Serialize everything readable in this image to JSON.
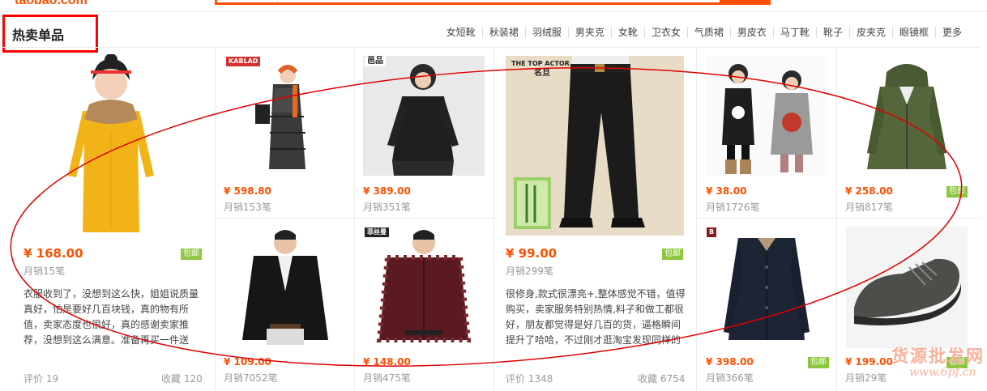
{
  "site": {
    "logo_text": "taobao.com"
  },
  "section": {
    "title": "热卖单品"
  },
  "categories": [
    "女短靴",
    "秋装裙",
    "羽绒服",
    "男夹克",
    "女靴",
    "卫衣女",
    "气质裙",
    "男皮衣",
    "马丁靴",
    "靴子",
    "皮夹克",
    "眼镜框",
    "更多"
  ],
  "featured": [
    {
      "price": "¥ 168.00",
      "badge": "包邮",
      "sales": "月销15笔",
      "review": "衣服收到了，没想到这么快，姐姐说质量真好，怕是要好几百块钱，真的物有所值，卖家态度也很好，真的感谢卖家推荐，没想到这么满意。准备再买一件送",
      "comments": "评价 19",
      "favorites": "收藏 120"
    },
    {
      "price": "¥ 99.00",
      "badge": "包邮",
      "sales": "月销299笔",
      "review": "很修身,款式很漂亮+,整体感觉不错，值得购买，卖家服务特别热情,料子和做工都很好，朋友都觉得是好几百的货，逼格瞬间提升了哈哈，不过刚才逛淘宝发现同样的",
      "comments": "评价 1348",
      "favorites": "收藏 6754"
    }
  ],
  "products": [
    {
      "price": "¥ 598.80",
      "sales": "月销153笔",
      "brand": "KABLAD",
      "badge": ""
    },
    {
      "price": "¥ 389.00",
      "sales": "月销351笔",
      "brand": "邑品",
      "badge": ""
    },
    {
      "price": "¥ 109.00",
      "sales": "月销7052笔",
      "brand": "",
      "badge": ""
    },
    {
      "price": "¥ 148.00",
      "sales": "月销475笔",
      "brand": "菲丝曼",
      "badge": ""
    },
    {
      "price": "¥ 38.00",
      "sales": "月销1726笔",
      "brand": "",
      "badge": ""
    },
    {
      "price": "¥ 258.00",
      "sales": "月销817笔",
      "brand": "",
      "badge": "包邮"
    },
    {
      "price": "¥ 398.00",
      "sales": "月销366笔",
      "brand": "B",
      "badge": "包邮"
    },
    {
      "price": "¥ 199.00",
      "sales": "月销29笔",
      "brand": "",
      "badge": "包邮"
    }
  ],
  "pants_brand": {
    "top": "THE TOP ACTOR",
    "bottom": "名旦"
  },
  "watermark": {
    "name": "货源批发网",
    "url": "www.6pf.cn"
  },
  "colors": {
    "accent": "#ff5000",
    "badge": "#8dc63f",
    "annotation": "#e00000"
  }
}
